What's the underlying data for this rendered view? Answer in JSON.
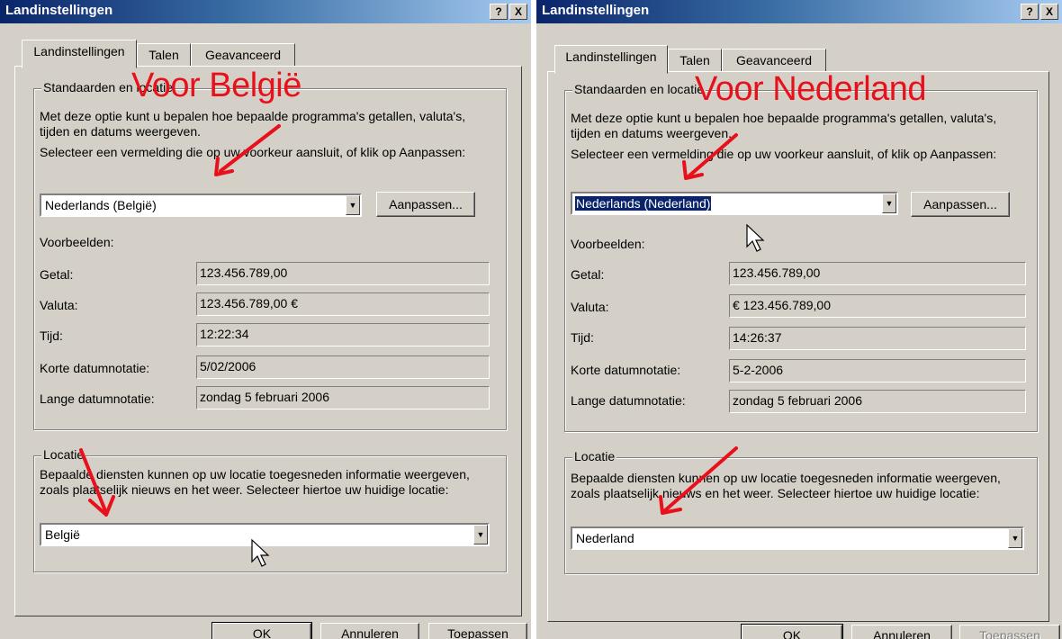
{
  "left": {
    "title": "Landinstellingen",
    "help_btn": "?",
    "close_btn": "X",
    "tabs": [
      "Landinstellingen",
      "Talen",
      "Geavanceerd"
    ],
    "annotation": "Voor België",
    "standards_group": "Standaarden en locatie",
    "desc1": "Met deze optie kunt u bepalen hoe bepaalde programma's getallen, valuta's, tijden en datums weergeven.",
    "desc2": "Selecteer een vermelding die op uw voorkeur aansluit, of klik op Aanpassen:",
    "locale_value": "Nederlands (België)",
    "customize_btn": "Aanpassen...",
    "examples_label": "Voorbeelden:",
    "examples": [
      {
        "label": "Getal:",
        "value": "123.456.789,00"
      },
      {
        "label": "Valuta:",
        "value": "123.456.789,00 €"
      },
      {
        "label": "Tijd:",
        "value": "12:22:34"
      },
      {
        "label": "Korte datumnotatie:",
        "value": "5/02/2006"
      },
      {
        "label": "Lange datumnotatie:",
        "value": "zondag 5 februari 2006"
      }
    ],
    "location_group": "Locatie",
    "location_desc": "Bepaalde diensten kunnen op uw locatie toegesneden informatie weergeven, zoals plaatselijk nieuws en het weer. Selecteer hiertoe uw huidige locatie:",
    "location_value": "België",
    "buttons": {
      "ok": "OK",
      "cancel": "Annuleren",
      "apply": "Toepassen"
    }
  },
  "right": {
    "title": "Landinstellingen",
    "help_btn": "?",
    "close_btn": "X",
    "tabs": [
      "Landinstellingen",
      "Talen",
      "Geavanceerd"
    ],
    "annotation": "Voor Nederland",
    "standards_group": "Standaarden en locatie",
    "desc1": "Met deze optie kunt u bepalen hoe bepaalde programma's getallen, valuta's, tijden en datums weergeven.",
    "desc2": "Selecteer een vermelding die op uw voorkeur aansluit, of klik op Aanpassen:",
    "locale_value": "Nederlands (Nederland)",
    "customize_btn": "Aanpassen...",
    "examples_label": "Voorbeelden:",
    "examples": [
      {
        "label": "Getal:",
        "value": "123.456.789,00"
      },
      {
        "label": "Valuta:",
        "value": "€ 123.456.789,00"
      },
      {
        "label": "Tijd:",
        "value": "14:26:37"
      },
      {
        "label": "Korte datumnotatie:",
        "value": "5-2-2006"
      },
      {
        "label": "Lange datumnotatie:",
        "value": "zondag 5 februari 2006"
      }
    ],
    "location_group": "Locatie",
    "location_desc": "Bepaalde diensten kunnen op uw locatie toegesneden informatie weergeven, zoals plaatselijk nieuws en het weer. Selecteer hiertoe uw huidige locatie:",
    "location_value": "Nederland",
    "buttons": {
      "ok": "OK",
      "cancel": "Annuleren",
      "apply": "Toepassen"
    }
  },
  "colors": {
    "annotation_red": "#e8101a",
    "titlebar": "#0a246a",
    "dialog_bg": "#d4d0c8",
    "selection": "#0a246a"
  }
}
